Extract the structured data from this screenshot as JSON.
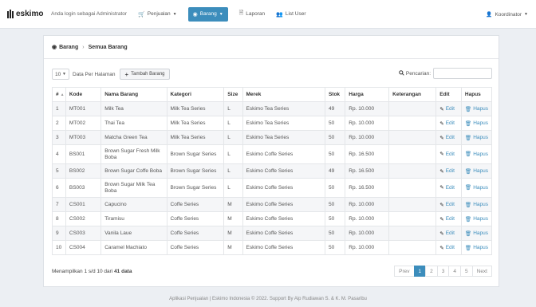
{
  "nav": {
    "brand": "eskimo",
    "login_text": "Anda login sebagai Administrator",
    "menu_penjualan": "Penjualan",
    "menu_barang": "Barang",
    "menu_laporan": "Laporan",
    "menu_list_user": "List User",
    "user": "Koordinator"
  },
  "breadcrumb": {
    "root": "Barang",
    "current": "Semua Barang"
  },
  "controls": {
    "page_length": "10",
    "page_length_label": "Data Per Halaman",
    "add_button": "Tambah Barang",
    "search_label": "Pencarian:",
    "search_value": ""
  },
  "table": {
    "headers": [
      "#",
      "Kode",
      "Nama Barang",
      "Kategori",
      "Size",
      "Merek",
      "Stok",
      "Harga",
      "Keterangan",
      "Edit",
      "Hapus"
    ],
    "edit_label": "Edit",
    "hapus_label": "Hapus",
    "rows": [
      {
        "no": "1",
        "kode": "MT001",
        "nama": "Milk Tea",
        "kategori": "Milk Tea Series",
        "size": "L",
        "merek": "Eskimo Tea Series",
        "stok": "49",
        "harga": "Rp. 10.000",
        "ket": ""
      },
      {
        "no": "2",
        "kode": "MT002",
        "nama": "Thai Tea",
        "kategori": "Milk Tea Series",
        "size": "L",
        "merek": "Eskimo Tea Series",
        "stok": "50",
        "harga": "Rp. 10.000",
        "ket": ""
      },
      {
        "no": "3",
        "kode": "MT003",
        "nama": "Matcha Green Tea",
        "kategori": "Milk Tea Series",
        "size": "L",
        "merek": "Eskimo Tea Series",
        "stok": "50",
        "harga": "Rp. 10.000",
        "ket": ""
      },
      {
        "no": "4",
        "kode": "BS001",
        "nama": "Brown Sugar Fresh Milk Boba",
        "kategori": "Brown Sugar Series",
        "size": "L",
        "merek": "Eskimo Coffe Series",
        "stok": "50",
        "harga": "Rp. 16.500",
        "ket": ""
      },
      {
        "no": "5",
        "kode": "BS002",
        "nama": "Brown Sugar Coffe Boba",
        "kategori": "Brown Sugar Series",
        "size": "L",
        "merek": "Eskimo Coffe Series",
        "stok": "49",
        "harga": "Rp. 16.500",
        "ket": ""
      },
      {
        "no": "6",
        "kode": "BS003",
        "nama": "Brown Sugar Milk Tea Boba",
        "kategori": "Brown Sugar Series",
        "size": "L",
        "merek": "Eskimo Coffe Series",
        "stok": "50",
        "harga": "Rp. 16.500",
        "ket": ""
      },
      {
        "no": "7",
        "kode": "CS001",
        "nama": "Capucino",
        "kategori": "Coffe Series",
        "size": "M",
        "merek": "Eskimo Coffe Series",
        "stok": "50",
        "harga": "Rp. 10.000",
        "ket": ""
      },
      {
        "no": "8",
        "kode": "CS002",
        "nama": "Tiramisu",
        "kategori": "Coffe Series",
        "size": "M",
        "merek": "Eskimo Coffe Series",
        "stok": "50",
        "harga": "Rp. 10.000",
        "ket": ""
      },
      {
        "no": "9",
        "kode": "CS003",
        "nama": "Vanila Laue",
        "kategori": "Coffe Series",
        "size": "M",
        "merek": "Eskimo Coffe Series",
        "stok": "50",
        "harga": "Rp. 10.000",
        "ket": ""
      },
      {
        "no": "10",
        "kode": "CS004",
        "nama": "Caramel Machiato",
        "kategori": "Coffe Series",
        "size": "M",
        "merek": "Eskimo Coffe Series",
        "stok": "50",
        "harga": "Rp. 10.000",
        "ket": ""
      }
    ]
  },
  "info": {
    "prefix": "Menampilkan 1 s/d 10 dari",
    "total": "41 data"
  },
  "pagination": {
    "prev": "Prev",
    "pages": [
      "1",
      "2",
      "3",
      "4",
      "5"
    ],
    "next": "Next",
    "active": "1"
  },
  "footer": "Aplikasi Penjualan | Eskimo Indonesia © 2022. Support By Aip Rudiawan S. & K. M. Pasaribu",
  "colors": {
    "accent": "#3c8dbc",
    "stripe": "#f5f6f8",
    "background": "#eceff3"
  }
}
